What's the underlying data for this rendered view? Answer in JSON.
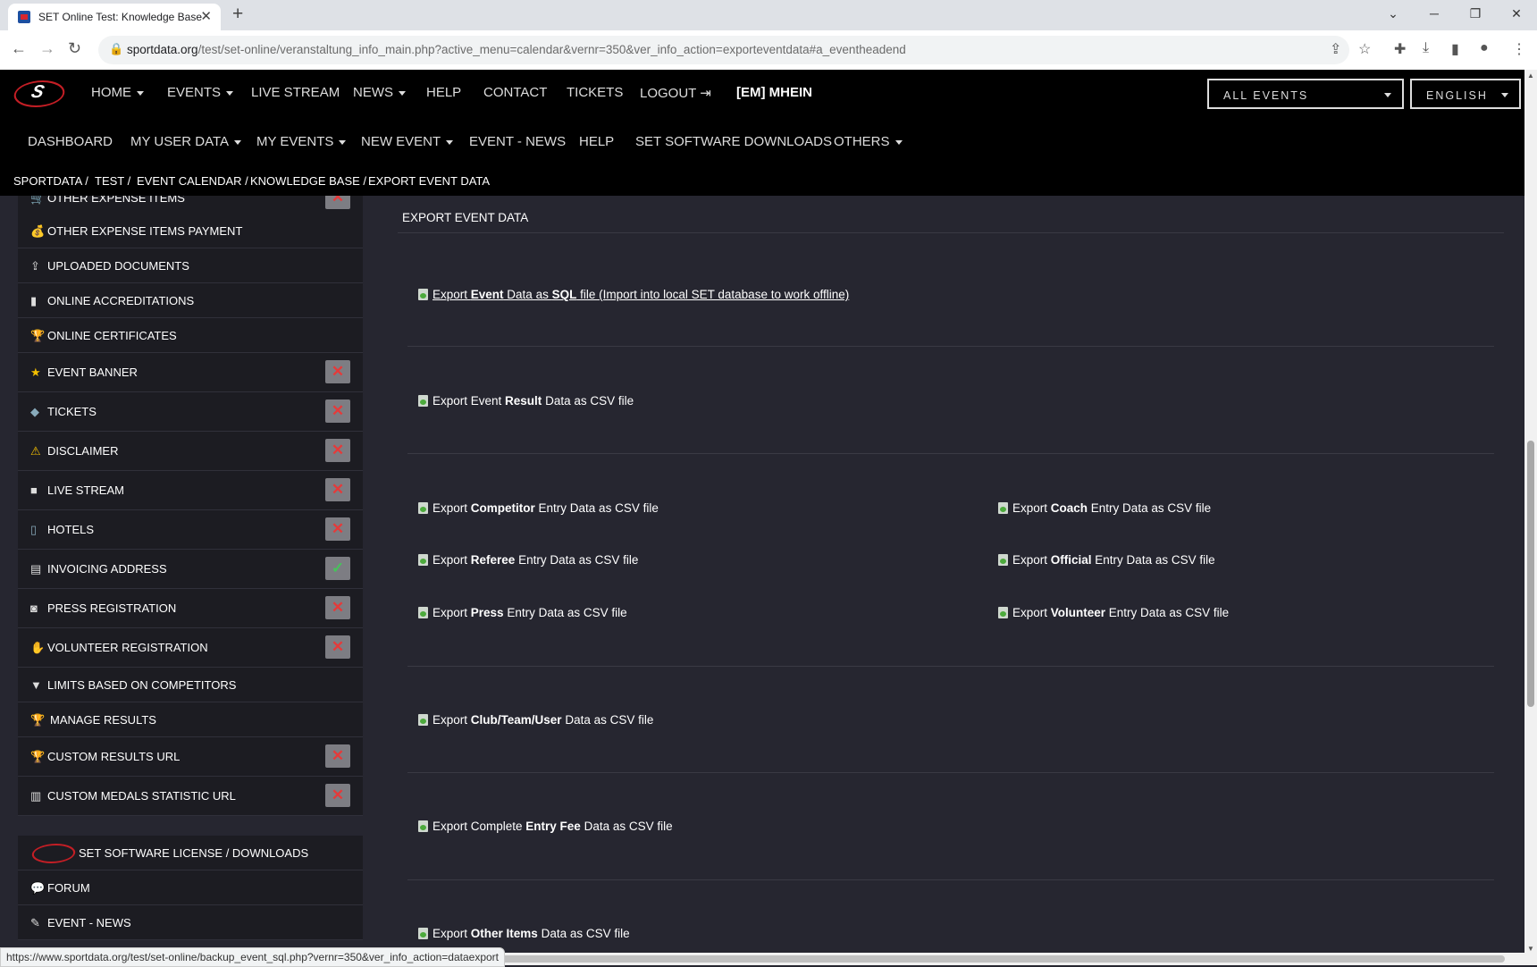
{
  "browser": {
    "tab_title": "SET Online Test: Knowledge Base",
    "url_host": "sportdata.org",
    "url_path": "/test/set-online/veranstaltung_info_main.php?active_menu=calendar&vernr=350&ver_info_action=exporteventdata#a_eventheadend",
    "status_url": "https://www.sportdata.org/test/set-online/backup_event_sql.php?vernr=350&ver_info_action=dataexport"
  },
  "nav1": {
    "home": "HOME",
    "events": "EVENTS",
    "live_stream": "LIVE STREAM",
    "news": "NEWS",
    "help": "HELP",
    "contact": "CONTACT",
    "tickets": "TICKETS",
    "logout": "LOGOUT",
    "user": "[EM] MHEIN",
    "events_select": "ALL EVENTS",
    "language_select": "ENGLISH"
  },
  "nav2": {
    "dashboard": "DASHBOARD",
    "my_user_data": "MY USER DATA",
    "my_events": "MY EVENTS",
    "new_event": "NEW EVENT",
    "event_news": "EVENT - NEWS",
    "help": "HELP",
    "downloads": "SET SOFTWARE DOWNLOADS",
    "others": "OTHERS"
  },
  "breadcrumb": [
    "SPORTDATA",
    "TEST",
    "EVENT CALENDAR",
    "KNOWLEDGE BASE",
    "EXPORT EVENT DATA"
  ],
  "sidebar": {
    "items": [
      {
        "label": "OTHER EXPENSE ITEMS",
        "icon": "cart-icon",
        "status": "x"
      },
      {
        "label": "OTHER EXPENSE ITEMS PAYMENT",
        "icon": "payment-icon",
        "status": ""
      },
      {
        "label": "UPLOADED DOCUMENTS",
        "icon": "upload-icon",
        "status": ""
      },
      {
        "label": "ONLINE ACCREDITATIONS",
        "icon": "badge-icon",
        "status": ""
      },
      {
        "label": "ONLINE CERTIFICATES",
        "icon": "trophy-icon",
        "status": ""
      },
      {
        "label": "EVENT BANNER",
        "icon": "star-icon",
        "status": "x"
      },
      {
        "label": "TICKETS",
        "icon": "ticket-icon",
        "status": "x"
      },
      {
        "label": "DISCLAIMER",
        "icon": "warning-icon",
        "status": "x"
      },
      {
        "label": "LIVE STREAM",
        "icon": "video-icon",
        "status": "x"
      },
      {
        "label": "HOTELS",
        "icon": "luggage-icon",
        "status": "x"
      },
      {
        "label": "INVOICING ADDRESS",
        "icon": "invoice-icon",
        "status": "ok"
      },
      {
        "label": "PRESS REGISTRATION",
        "icon": "camera-icon",
        "status": "x"
      },
      {
        "label": "VOLUNTEER REGISTRATION",
        "icon": "hand-icon",
        "status": "x"
      },
      {
        "label": "LIMITS BASED ON COMPETITORS",
        "icon": "filter-icon",
        "status": ""
      },
      {
        "label": "MANAGE RESULTS",
        "icon": "trophy-icon",
        "status": ""
      },
      {
        "label": "CUSTOM RESULTS URL",
        "icon": "trophy-icon",
        "status": "x"
      },
      {
        "label": "CUSTOM MEDALS STATISTIC URL",
        "icon": "bar-chart-icon",
        "status": "x"
      }
    ],
    "bottom": [
      {
        "label": "SET SOFTWARE LICENSE / DOWNLOADS",
        "icon": "set-logo-icon"
      },
      {
        "label": "FORUM",
        "icon": "forum-icon"
      },
      {
        "label": "EVENT - NEWS",
        "icon": "news-icon"
      }
    ]
  },
  "main": {
    "heading": "EXPORT EVENT DATA",
    "links": {
      "sql": {
        "pre": "Export ",
        "bold": "Event",
        "mid": " Data as ",
        "bold2": "SQL",
        "post": " file (Import into local SET database to work offline)"
      },
      "result": {
        "pre": "Export Event ",
        "bold": "Result",
        "post": " Data as CSV file"
      },
      "competitor": {
        "pre": "Export ",
        "bold": "Competitor",
        "post": " Entry Data as CSV file"
      },
      "coach": {
        "pre": "Export ",
        "bold": "Coach",
        "post": " Entry Data as CSV file"
      },
      "referee": {
        "pre": "Export ",
        "bold": "Referee",
        "post": " Entry Data as CSV file"
      },
      "official": {
        "pre": "Export ",
        "bold": "Official",
        "post": " Entry Data as CSV file"
      },
      "press": {
        "pre": "Export ",
        "bold": "Press",
        "post": " Entry Data as CSV file"
      },
      "volunteer": {
        "pre": "Export ",
        "bold": "Volunteer",
        "post": " Entry Data as CSV file"
      },
      "club": {
        "pre": "Export ",
        "bold": "Club/Team/User",
        "post": " Data as CSV file"
      },
      "entry_fee": {
        "pre": "Export Complete ",
        "bold": "Entry Fee",
        "post": " Data as CSV file"
      },
      "other_items": {
        "pre": "Export ",
        "bold": "Other Items",
        "post": " Data as CSV file"
      }
    }
  },
  "colors": {
    "page_bg": "#262630",
    "sidebar_item_bg": "#1c1c22",
    "header_bg": "#000000",
    "badge_bg": "#7d7d83",
    "badge_x": "#e53a3a",
    "badge_ok": "#46c35a"
  }
}
